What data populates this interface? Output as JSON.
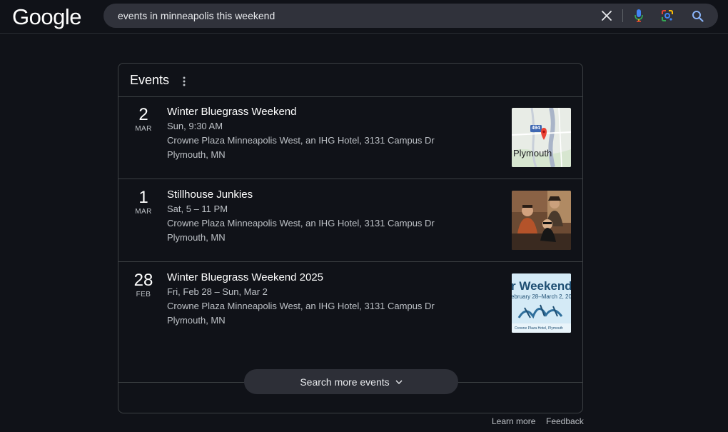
{
  "header": {
    "logo_text": "Google",
    "search": {
      "query": "events in minneapolis this weekend"
    },
    "icons": {
      "clear": "close-icon",
      "voice": "microphone-icon",
      "lens": "google-lens-icon",
      "search": "search-icon"
    }
  },
  "card": {
    "title": "Events",
    "events": [
      {
        "day": "2",
        "month": "MAR",
        "title": "Winter Bluegrass Weekend",
        "time": "Sun, 9:30 AM",
        "venue": "Crowne Plaza Minneapolis West, an IHG Hotel, 3131 Campus Dr",
        "city": "Plymouth, MN",
        "thumb": {
          "type": "map",
          "label": "Plymouth",
          "route": "494"
        }
      },
      {
        "day": "1",
        "month": "MAR",
        "title": "Stillhouse Junkies",
        "time": "Sat, 5 – 11 PM",
        "venue": "Crowne Plaza Minneapolis West, an IHG Hotel, 3131 Campus Dr",
        "city": "Plymouth, MN",
        "thumb": {
          "type": "photo"
        }
      },
      {
        "day": "28",
        "month": "FEB",
        "title": "Winter Bluegrass Weekend 2025",
        "time": "Fri, Feb 28 – Sun, Mar 2",
        "venue": "Crowne Plaza Minneapolis West, an IHG Hotel, 3131 Campus Dr",
        "city": "Plymouth, MN",
        "thumb": {
          "type": "poster",
          "headline": "r Weekend",
          "dates": "ebruary 28–March 2, 20",
          "footer": "Crowne Plaza Hotel, Plymouth"
        }
      }
    ],
    "more_button": "Search more events"
  },
  "footer": {
    "learn_more": "Learn more",
    "feedback": "Feedback"
  },
  "colors": {
    "background": "#101218",
    "searchbox": "#30323b",
    "border": "#3c4043",
    "text_primary": "#ffffff",
    "text_secondary": "#bdc1c6"
  }
}
